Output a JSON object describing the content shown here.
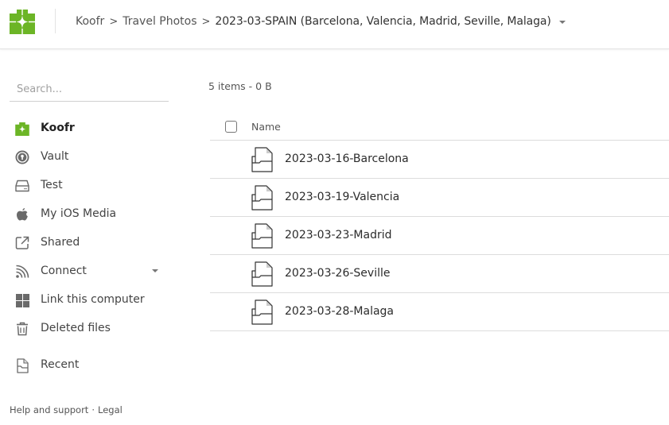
{
  "brand": {
    "name": "Koofr",
    "color": "#6cb526"
  },
  "breadcrumb": {
    "items": [
      "Koofr",
      "Travel Photos"
    ],
    "separator": ">",
    "current": "2023-03-SPAIN (Barcelona, Valencia, Madrid, Seville, Malaga)"
  },
  "sidebar": {
    "search_placeholder": "Search...",
    "items": [
      {
        "label": "Koofr",
        "icon": "koofr-logo-icon",
        "active": true
      },
      {
        "label": "Vault",
        "icon": "vault-icon"
      },
      {
        "label": "Test",
        "icon": "drive-icon"
      },
      {
        "label": "My iOS Media",
        "icon": "apple-icon"
      },
      {
        "label": "Shared",
        "icon": "shared-link-icon"
      },
      {
        "label": "Connect",
        "icon": "connect-icon",
        "has_dropdown": true
      },
      {
        "label": "Link this computer",
        "icon": "windows-icon"
      },
      {
        "label": "Deleted files",
        "icon": "trash-icon"
      },
      {
        "label": "Recent",
        "icon": "recent-icon"
      }
    ],
    "footer": {
      "help": "Help and support",
      "separator": "·",
      "legal": "Legal"
    }
  },
  "main": {
    "summary": "5 items - 0 B",
    "columns": {
      "name": "Name"
    },
    "rows": [
      {
        "name": "2023-03-16-Barcelona",
        "type": "folder"
      },
      {
        "name": "2023-03-19-Valencia",
        "type": "folder"
      },
      {
        "name": "2023-03-23-Madrid",
        "type": "folder"
      },
      {
        "name": "2023-03-26-Seville",
        "type": "folder"
      },
      {
        "name": "2023-03-28-Malaga",
        "type": "folder"
      }
    ]
  }
}
